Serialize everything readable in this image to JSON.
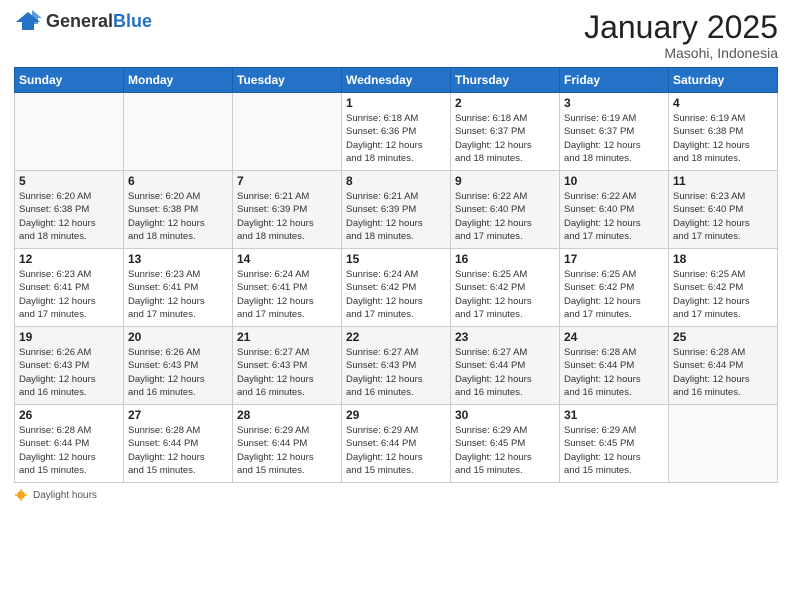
{
  "header": {
    "logo_general": "General",
    "logo_blue": "Blue",
    "month_title": "January 2025",
    "location": "Masohi, Indonesia"
  },
  "weekdays": [
    "Sunday",
    "Monday",
    "Tuesday",
    "Wednesday",
    "Thursday",
    "Friday",
    "Saturday"
  ],
  "footer": {
    "daylight_label": "Daylight hours"
  },
  "weeks": [
    [
      {
        "day": "",
        "info": ""
      },
      {
        "day": "",
        "info": ""
      },
      {
        "day": "",
        "info": ""
      },
      {
        "day": "1",
        "info": "Sunrise: 6:18 AM\nSunset: 6:36 PM\nDaylight: 12 hours\nand 18 minutes."
      },
      {
        "day": "2",
        "info": "Sunrise: 6:18 AM\nSunset: 6:37 PM\nDaylight: 12 hours\nand 18 minutes."
      },
      {
        "day": "3",
        "info": "Sunrise: 6:19 AM\nSunset: 6:37 PM\nDaylight: 12 hours\nand 18 minutes."
      },
      {
        "day": "4",
        "info": "Sunrise: 6:19 AM\nSunset: 6:38 PM\nDaylight: 12 hours\nand 18 minutes."
      }
    ],
    [
      {
        "day": "5",
        "info": "Sunrise: 6:20 AM\nSunset: 6:38 PM\nDaylight: 12 hours\nand 18 minutes."
      },
      {
        "day": "6",
        "info": "Sunrise: 6:20 AM\nSunset: 6:38 PM\nDaylight: 12 hours\nand 18 minutes."
      },
      {
        "day": "7",
        "info": "Sunrise: 6:21 AM\nSunset: 6:39 PM\nDaylight: 12 hours\nand 18 minutes."
      },
      {
        "day": "8",
        "info": "Sunrise: 6:21 AM\nSunset: 6:39 PM\nDaylight: 12 hours\nand 18 minutes."
      },
      {
        "day": "9",
        "info": "Sunrise: 6:22 AM\nSunset: 6:40 PM\nDaylight: 12 hours\nand 17 minutes."
      },
      {
        "day": "10",
        "info": "Sunrise: 6:22 AM\nSunset: 6:40 PM\nDaylight: 12 hours\nand 17 minutes."
      },
      {
        "day": "11",
        "info": "Sunrise: 6:23 AM\nSunset: 6:40 PM\nDaylight: 12 hours\nand 17 minutes."
      }
    ],
    [
      {
        "day": "12",
        "info": "Sunrise: 6:23 AM\nSunset: 6:41 PM\nDaylight: 12 hours\nand 17 minutes."
      },
      {
        "day": "13",
        "info": "Sunrise: 6:23 AM\nSunset: 6:41 PM\nDaylight: 12 hours\nand 17 minutes."
      },
      {
        "day": "14",
        "info": "Sunrise: 6:24 AM\nSunset: 6:41 PM\nDaylight: 12 hours\nand 17 minutes."
      },
      {
        "day": "15",
        "info": "Sunrise: 6:24 AM\nSunset: 6:42 PM\nDaylight: 12 hours\nand 17 minutes."
      },
      {
        "day": "16",
        "info": "Sunrise: 6:25 AM\nSunset: 6:42 PM\nDaylight: 12 hours\nand 17 minutes."
      },
      {
        "day": "17",
        "info": "Sunrise: 6:25 AM\nSunset: 6:42 PM\nDaylight: 12 hours\nand 17 minutes."
      },
      {
        "day": "18",
        "info": "Sunrise: 6:25 AM\nSunset: 6:42 PM\nDaylight: 12 hours\nand 17 minutes."
      }
    ],
    [
      {
        "day": "19",
        "info": "Sunrise: 6:26 AM\nSunset: 6:43 PM\nDaylight: 12 hours\nand 16 minutes."
      },
      {
        "day": "20",
        "info": "Sunrise: 6:26 AM\nSunset: 6:43 PM\nDaylight: 12 hours\nand 16 minutes."
      },
      {
        "day": "21",
        "info": "Sunrise: 6:27 AM\nSunset: 6:43 PM\nDaylight: 12 hours\nand 16 minutes."
      },
      {
        "day": "22",
        "info": "Sunrise: 6:27 AM\nSunset: 6:43 PM\nDaylight: 12 hours\nand 16 minutes."
      },
      {
        "day": "23",
        "info": "Sunrise: 6:27 AM\nSunset: 6:44 PM\nDaylight: 12 hours\nand 16 minutes."
      },
      {
        "day": "24",
        "info": "Sunrise: 6:28 AM\nSunset: 6:44 PM\nDaylight: 12 hours\nand 16 minutes."
      },
      {
        "day": "25",
        "info": "Sunrise: 6:28 AM\nSunset: 6:44 PM\nDaylight: 12 hours\nand 16 minutes."
      }
    ],
    [
      {
        "day": "26",
        "info": "Sunrise: 6:28 AM\nSunset: 6:44 PM\nDaylight: 12 hours\nand 15 minutes."
      },
      {
        "day": "27",
        "info": "Sunrise: 6:28 AM\nSunset: 6:44 PM\nDaylight: 12 hours\nand 15 minutes."
      },
      {
        "day": "28",
        "info": "Sunrise: 6:29 AM\nSunset: 6:44 PM\nDaylight: 12 hours\nand 15 minutes."
      },
      {
        "day": "29",
        "info": "Sunrise: 6:29 AM\nSunset: 6:44 PM\nDaylight: 12 hours\nand 15 minutes."
      },
      {
        "day": "30",
        "info": "Sunrise: 6:29 AM\nSunset: 6:45 PM\nDaylight: 12 hours\nand 15 minutes."
      },
      {
        "day": "31",
        "info": "Sunrise: 6:29 AM\nSunset: 6:45 PM\nDaylight: 12 hours\nand 15 minutes."
      },
      {
        "day": "",
        "info": ""
      }
    ]
  ]
}
